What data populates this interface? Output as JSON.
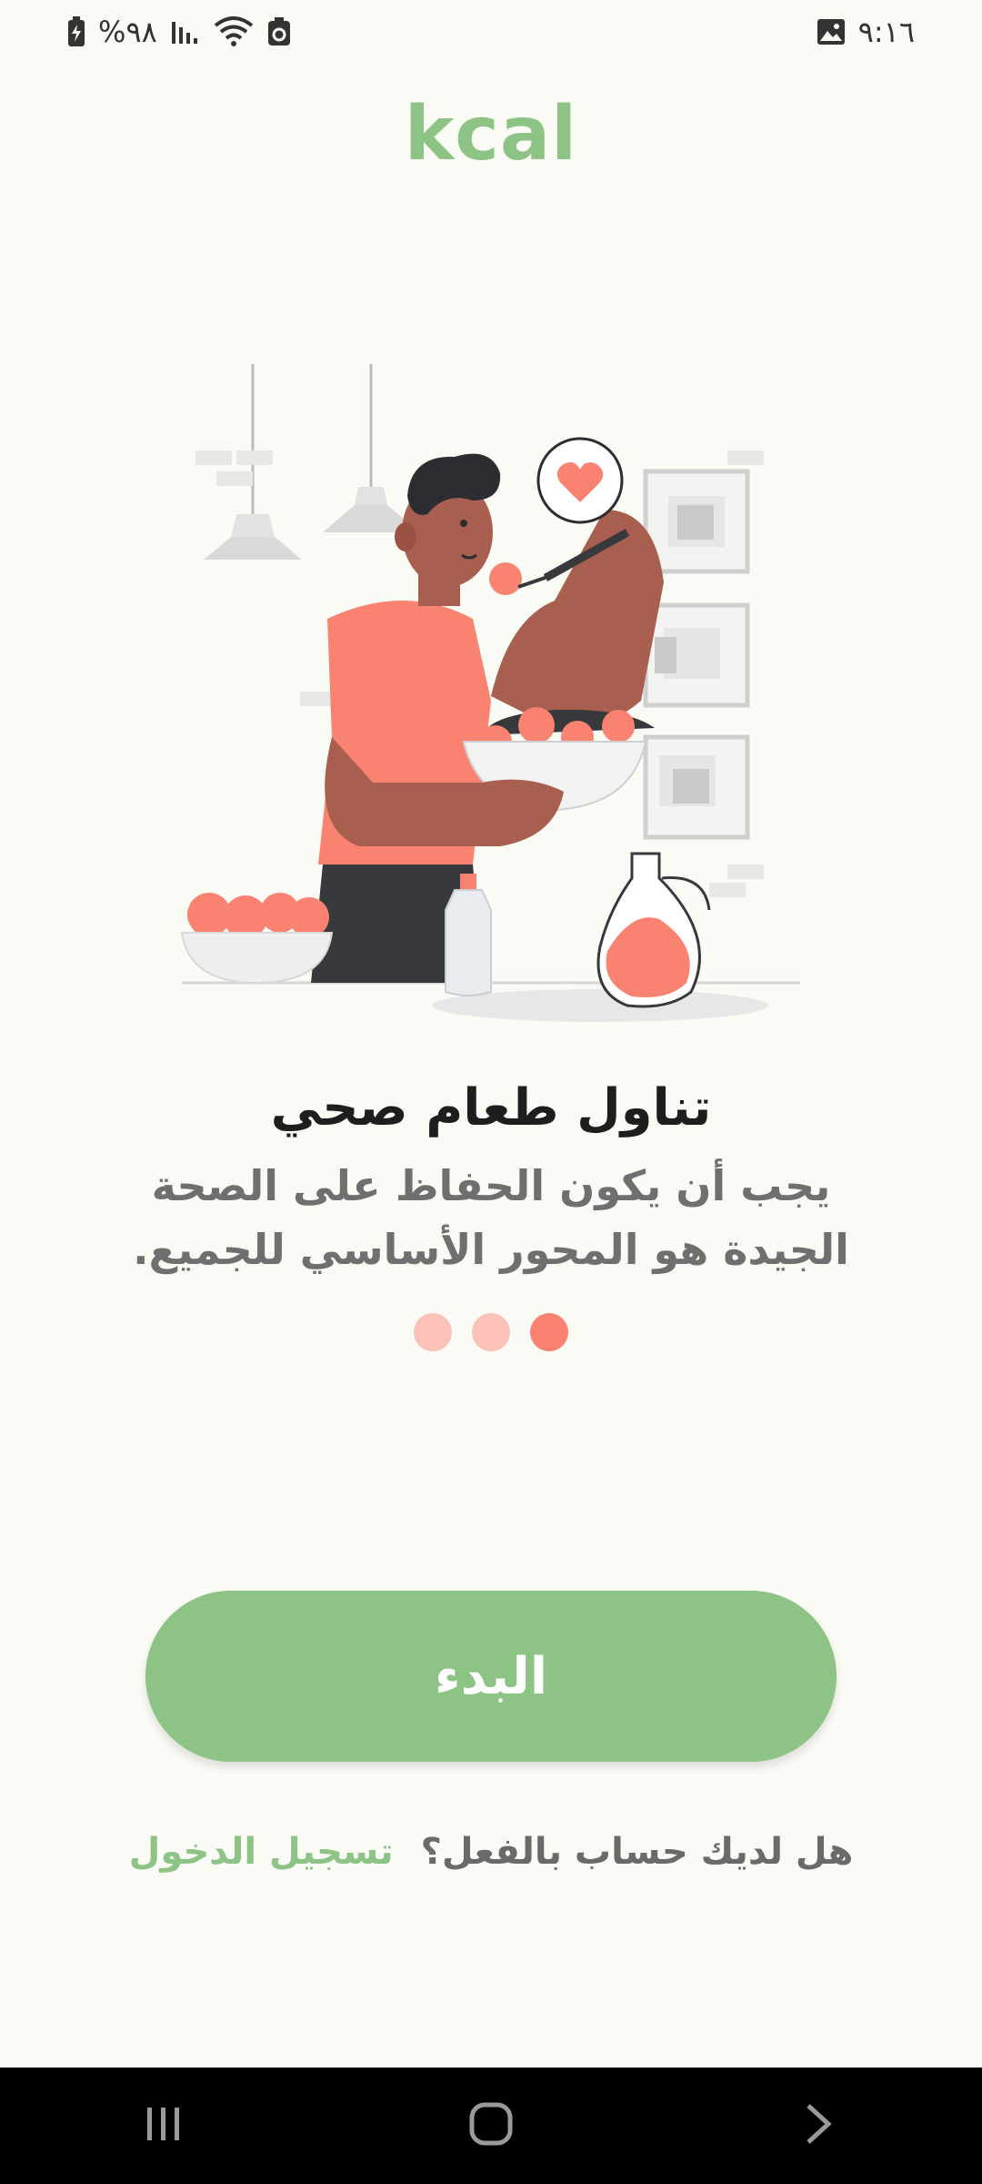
{
  "status_bar": {
    "battery_text": "%٩٨",
    "time": "٩:١٦"
  },
  "app": {
    "title": "kcal"
  },
  "slide": {
    "title": "تناول طعام صحي",
    "description": "يجب أن يكون الحفاظ على الصحة الجيدة هو المحور الأساسي للجميع.",
    "page_count": 3,
    "active_page": 3
  },
  "actions": {
    "start_label": "البدء",
    "login_question": "هل لديك حساب بالفعل؟",
    "login_link": "تسجيل الدخول"
  },
  "icons": {
    "status_left": [
      "battery-charging-icon",
      "signal-icon",
      "wifi-icon",
      "recycle-icon"
    ],
    "status_right": [
      "image-notification-icon"
    ],
    "nav": [
      "recent-apps-icon",
      "home-icon",
      "back-icon"
    ]
  },
  "colors": {
    "brand_green": "#8dc385",
    "accent_coral": "#f98270",
    "dot_inactive": "#fcc1b8",
    "background": "#fbfbf6"
  }
}
